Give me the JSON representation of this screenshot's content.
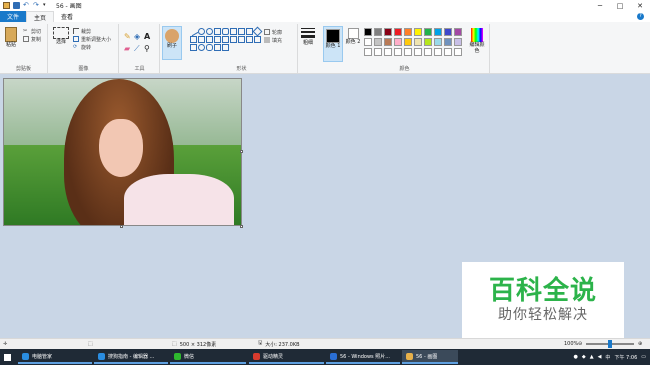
{
  "window": {
    "title": "56 - 画图"
  },
  "tabs": {
    "file": "文件",
    "home": "主页",
    "view": "查看"
  },
  "ribbon": {
    "clipboard": {
      "paste": "粘贴",
      "cut": "剪切",
      "copy": "复制",
      "group": "剪贴板"
    },
    "image": {
      "select": "选择",
      "crop": "裁剪",
      "resize": "重新调整大小",
      "rotate": "旋转",
      "group": "图像"
    },
    "tools": {
      "group": "工具"
    },
    "brushes": {
      "label": "刷子"
    },
    "shapes": {
      "outline": "轮廓",
      "fill": "填充",
      "group": "形状"
    },
    "size": {
      "label": "粗细"
    },
    "colors": {
      "color1": "颜色 1",
      "color2": "颜色 2",
      "edit": "编辑颜色",
      "group": "颜色",
      "palette": [
        "#000000",
        "#7f7f7f",
        "#880015",
        "#ed1c24",
        "#ff7f27",
        "#fff200",
        "#22b14c",
        "#00a2e8",
        "#3f48cc",
        "#a349a4",
        "#ffffff",
        "#c3c3c3",
        "#b97a57",
        "#ffaec9",
        "#ffc90e",
        "#efe4b0",
        "#b5e61d",
        "#99d9ea",
        "#7092be",
        "#c8bfe7",
        "#ffffff",
        "#ffffff",
        "#ffffff",
        "#ffffff",
        "#ffffff",
        "#ffffff",
        "#ffffff",
        "#ffffff",
        "#ffffff",
        "#ffffff"
      ]
    }
  },
  "watermark": {
    "line1": "百科全说",
    "line2": "助你轻松解决"
  },
  "statusbar": {
    "dimensions": "500 × 312像素",
    "filesize": "大小: 237.0KB",
    "zoom": "100%"
  },
  "taskbar": {
    "apps": [
      {
        "label": "电脑管家",
        "color": "#2a8de0"
      },
      {
        "label": "搜狗指南 - 编辑器 ...",
        "color": "#2a8de0"
      },
      {
        "label": "微信",
        "color": "#2eb82e"
      },
      {
        "label": "驱动精灵",
        "color": "#d83b2e"
      },
      {
        "label": "56 - Windows 照片...",
        "color": "#2a6fd6"
      },
      {
        "label": "56 - 画图",
        "color": "#e6b04a"
      }
    ],
    "time": "下午 7:06"
  }
}
